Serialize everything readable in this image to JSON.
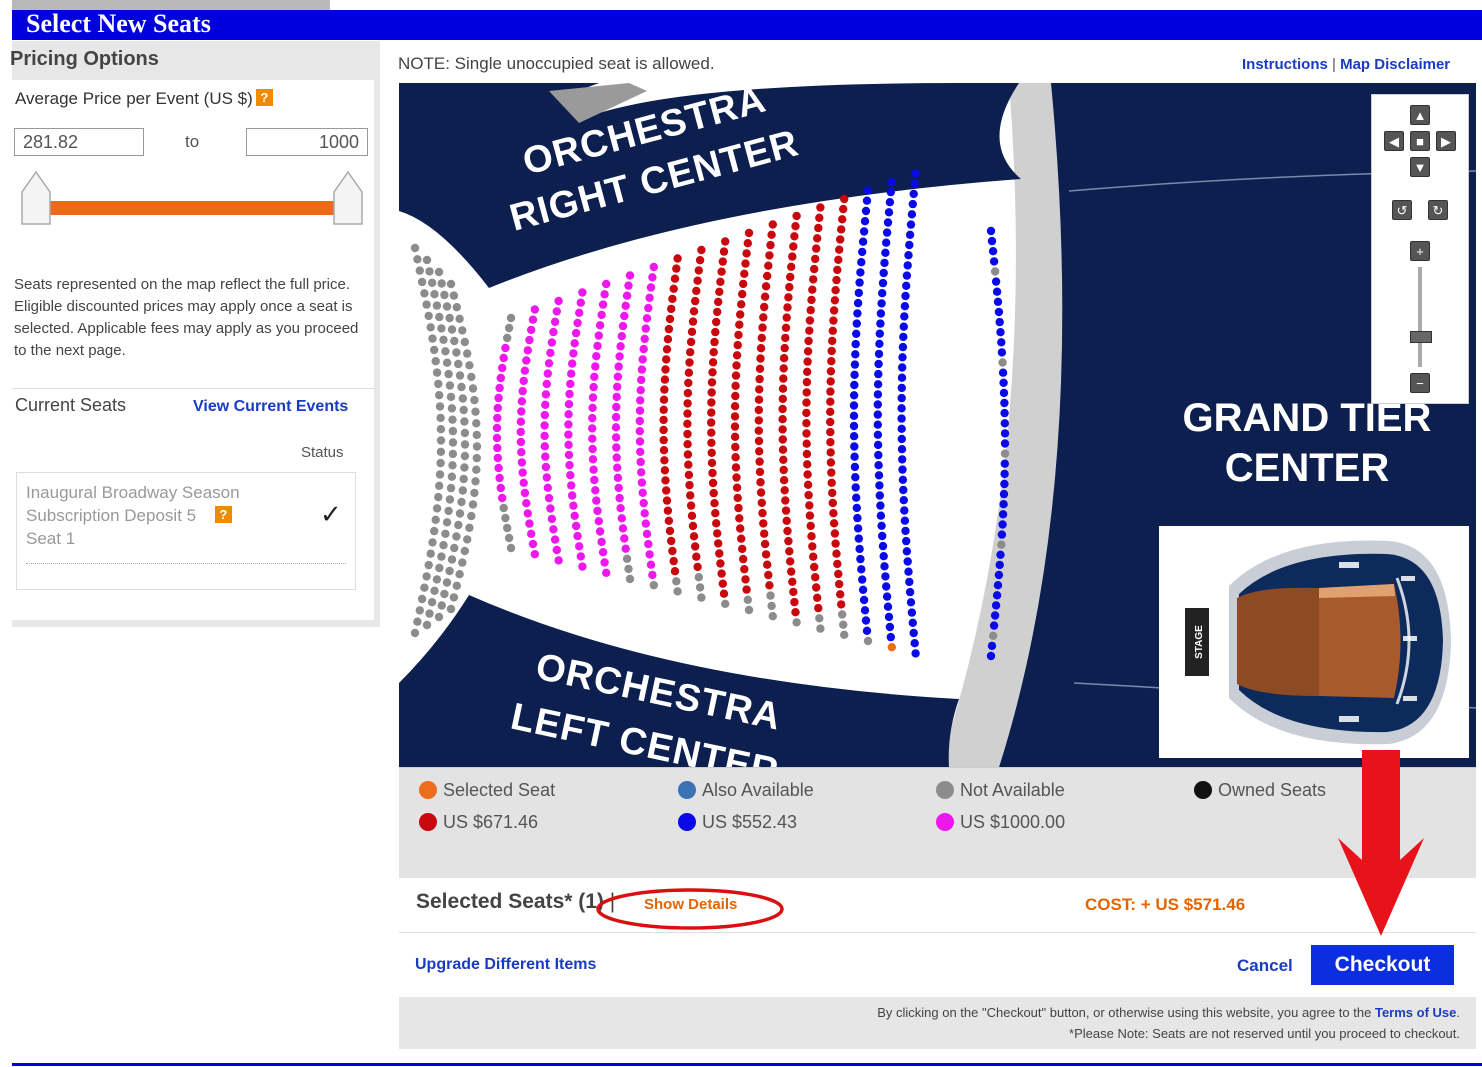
{
  "header": {
    "title": "Select New Seats"
  },
  "pricing": {
    "title": "Pricing Options",
    "avg_label": "Average Price per Event (US $)",
    "help_icon": "?",
    "min_value": "281.82",
    "to_label": "to",
    "max_value": "1000",
    "disclaimer": "Seats represented on the map reflect the full price. Eligible discounted prices may apply once a seat is selected. Applicable fees may apply as you proceed to the next page."
  },
  "current_seats": {
    "title": "Current Seats",
    "view_link": "View Current Events",
    "status_header": "Status",
    "item_line1": "Inaugural Broadway Season",
    "item_line2": "Subscription Deposit 5",
    "item_line3": "Seat 1",
    "check": "✓"
  },
  "map": {
    "note": "NOTE: Single unoccupied seat is allowed.",
    "instructions_link": "Instructions",
    "separator": "|",
    "disclaimer_link": "Map Disclaimer",
    "section_orc_right_1": "ORCHESTRA",
    "section_orc_right_2": "RIGHT CENTER",
    "section_orc_left_1": "ORCHESTRA",
    "section_orc_left_2": "LEFT CENTER",
    "section_grand_1": "GRAND TIER",
    "section_grand_2": "CENTER",
    "minimap_stage": "STAGE",
    "colors": {
      "navy": "#0c1f4f",
      "red": "#c8080d",
      "blue": "#0a0ae8",
      "magenta": "#ee18ee",
      "gray": "#8c8c8c",
      "orange": "#ec6d1c"
    }
  },
  "legend": {
    "selected": "Selected Seat",
    "also_available": "Also Available",
    "not_available": "Not Available",
    "owned": "Owned Seats",
    "price_red": "US $671.46",
    "price_blue": "US $552.43",
    "price_magenta": "US $1000.00"
  },
  "selection": {
    "label": "Selected Seats* (1)",
    "separator": "|",
    "show_details": "Show Details",
    "cost": "COST: + US $571.46"
  },
  "actions": {
    "upgrade": "Upgrade Different Items",
    "cancel": "Cancel",
    "checkout": "Checkout"
  },
  "footer": {
    "line1_prefix": "By clicking on the \"Checkout\" button, or otherwise using this website, you agree to the",
    "terms_link": "Terms of Use",
    "line2": "*Please Note: Seats are not reserved until you proceed to checkout."
  }
}
